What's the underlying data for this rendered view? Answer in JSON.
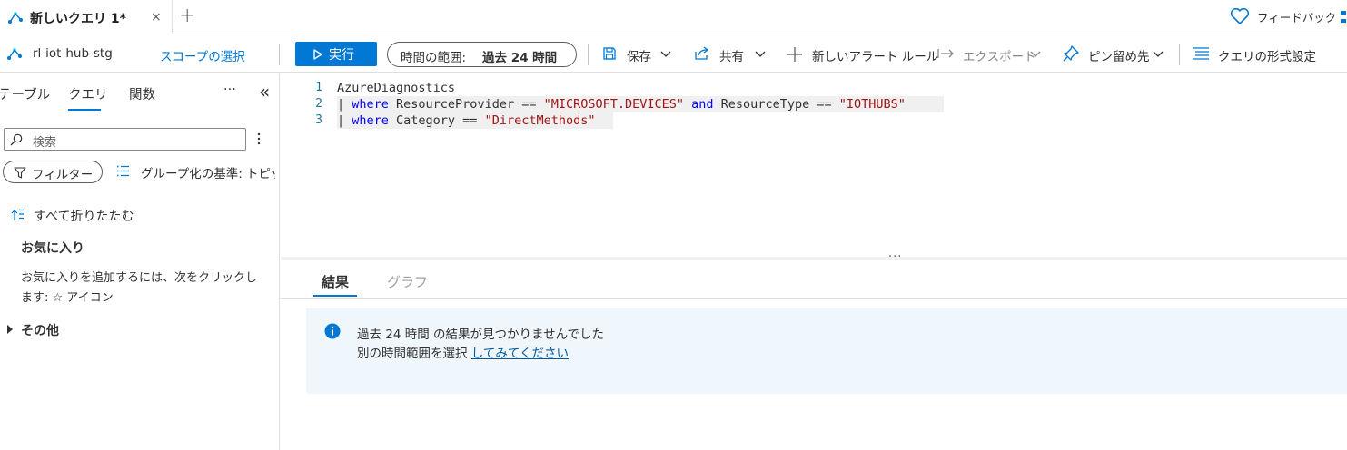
{
  "tab": {
    "title": "新しいクエリ 1*",
    "close": "×",
    "new_tab": "+"
  },
  "header": {
    "feedback_label": "フィードバック"
  },
  "toolbar": {
    "resource": "rl-iot-hub-stg",
    "scope_select": "スコープの選択",
    "run_label": "実行",
    "time_range_label": "時間の範囲:",
    "time_range_value": "過去 24 時間",
    "save_label": "保存",
    "share_label": "共有",
    "new_alert_label": "新しいアラート ルール",
    "export_label": "エクスポート",
    "pin_label": "ピン留め先",
    "format_label": "クエリの形式設定"
  },
  "left_panel": {
    "tabs": [
      "テーブル",
      "クエリ",
      "関数"
    ],
    "active_tab": "クエリ",
    "more": "···",
    "collapse": "«",
    "search_placeholder": "検索",
    "filter_label": "フィルター",
    "group_by_label": "グループ化の基準: トピック",
    "collapse_all_label": "すべて折りたたむ",
    "favorites_title": "お気に入り",
    "favorites_desc": "お気に入りを追加するには、次をクリックします:  ☆ アイコン",
    "other_label": "その他"
  },
  "editor": {
    "line_numbers": [
      "1",
      "2",
      "3"
    ],
    "lines": {
      "l1": {
        "text": "AzureDiagnostics"
      },
      "l2": {
        "pipe": "| ",
        "kw1": "where",
        "t1": " ResourceProvider == ",
        "s1": "\"MICROSOFT.DEVICES\"",
        "kw2": " and",
        "t2": " ResourceType == ",
        "s2": "\"IOTHUBS\""
      },
      "l3": {
        "pipe": "| ",
        "kw1": "where",
        "t1": " Category == ",
        "s1": "\"DirectMethods\""
      }
    },
    "splitter": "···"
  },
  "results": {
    "tabs": [
      "結果",
      "グラフ"
    ],
    "active_tab": "結果",
    "info_line1": "過去 24 時間 の結果が見つかりませんでした",
    "info_line2_prefix": "別の時間範囲を選択 ",
    "info_line2_link": "してみてください"
  },
  "colors": {
    "accent": "#0078d4",
    "keyword": "#0000ff",
    "string": "#a31515",
    "info_bg": "#eff6fc"
  },
  "icons": {
    "tab": "query-icon",
    "feedback": "heart-icon",
    "resource": "iot-hub-icon",
    "run": "play-icon",
    "save": "save-icon",
    "share": "share-icon",
    "new_alert": "plus-icon",
    "export": "export-icon",
    "pin": "pin-icon",
    "format": "format-icon",
    "search": "search-icon",
    "filter": "filter-icon",
    "group": "list-icon",
    "collapse": "collapse-all-icon",
    "other": "caret-right-icon",
    "info": "info-icon"
  }
}
